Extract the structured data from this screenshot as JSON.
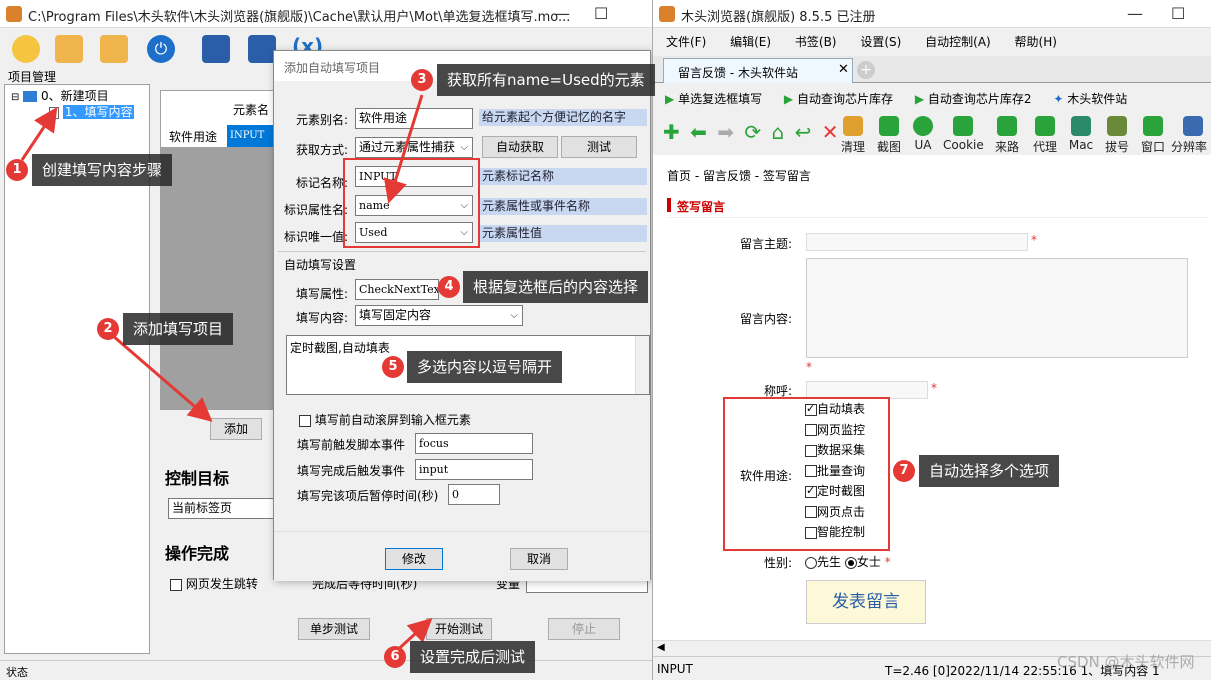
{
  "left_window": {
    "title": "C:\\Program Files\\木头软件\\木头浏览器(旗舰版)\\Cache\\默认用户\\Mot\\单选复选框填写.mo...",
    "project_panel_title": "项目管理",
    "tree": {
      "root": "0、新建项目",
      "child": "1、填写内容"
    },
    "grid": {
      "col_header": "元素名",
      "row_name": "软件用途",
      "row_value": "INPUT"
    },
    "add_button": "添加",
    "control_target_title": "控制目标",
    "current_tab": "当前标签页",
    "op_complete_title": "操作完成",
    "page_jump_label": "网页发生跳转",
    "wait_label": "完成后等待时间(秒)",
    "var_label": "变量",
    "step_test_button": "单步测试",
    "start_test_button": "开始测试",
    "stop_button": "停止",
    "status_label": "状态"
  },
  "dialog": {
    "title": "添加自动填写项目",
    "alias_label": "元素别名:",
    "alias_value": "软件用途",
    "alias_hint": "给元素起个方便记忆的名字",
    "method_label": "获取方式:",
    "method_value": "通过元素属性捕获",
    "auto_get_button": "自动获取",
    "test_button": "测试",
    "tag_label": "标记名称:",
    "tag_value": "INPUT",
    "tag_hint": "元素标记名称",
    "attr_label": "标识属性名:",
    "attr_value": "name",
    "attr_hint": "元素属性或事件名称",
    "unique_label": "标识唯一值:",
    "unique_value": "Used",
    "unique_hint": "元素属性值",
    "autofill_section": "自动填写设置",
    "fill_attr_label": "填写属性:",
    "fill_attr_value": "CheckNextText",
    "fill_content_label": "填写内容:",
    "fill_content_value": "填写固定内容",
    "textarea_value": "定时截图,自动填表",
    "scroll_check_label": "填写前自动滚屏到输入框元素",
    "before_event_label": "填写前触发脚本事件",
    "before_event_value": "focus",
    "after_event_label": "填写完成后触发事件",
    "after_event_value": "input",
    "pause_label": "填写完该项后暂停时间(秒)",
    "pause_value": "0",
    "modify_button": "修改",
    "cancel_button": "取消"
  },
  "browser": {
    "title": "木头浏览器(旗舰版) 8.5.5  已注册",
    "menu": [
      "文件(F)",
      "编辑(E)",
      "书签(B)",
      "设置(S)",
      "自动控制(A)",
      "帮助(H)"
    ],
    "tab": "留言反馈 - 木头软件站",
    "bookmarks": [
      "单选复选框填写",
      "自动查询芯片库存",
      "自动查询芯片库存2",
      "木头软件站"
    ],
    "tools": [
      "清理",
      "截图",
      "UA",
      "Cookie",
      "来路",
      "代理",
      "Mac",
      "拔号",
      "窗口",
      "分辨率"
    ],
    "breadcrumb": "首页 - 留言反馈 - 签写留言",
    "section_title": "签写留言",
    "subject_label": "留言主题:",
    "content_label": "留言内容:",
    "name_label": "称呼:",
    "usage_label": "软件用途:",
    "options": [
      {
        "label": "自动填表",
        "checked": true
      },
      {
        "label": "网页监控",
        "checked": false
      },
      {
        "label": "数据采集",
        "checked": false
      },
      {
        "label": "批量查询",
        "checked": false
      },
      {
        "label": "定时截图",
        "checked": true
      },
      {
        "label": "网页点击",
        "checked": false
      },
      {
        "label": "智能控制",
        "checked": false
      }
    ],
    "gender_label": "性别:",
    "gender_male": "先生",
    "gender_female": "女士",
    "submit": "发表留言",
    "status_left": "INPUT",
    "status_right": "T=2.46  [0]2022/11/14 22:55:16 1、填写内容 1",
    "watermark": "CSDN @木头软件网"
  },
  "callouts": [
    {
      "n": "1",
      "text": "创建填写内容步骤"
    },
    {
      "n": "2",
      "text": "添加填写项目"
    },
    {
      "n": "3",
      "text": "获取所有name=Used的元素"
    },
    {
      "n": "4",
      "text": "根据复选框后的内容选择"
    },
    {
      "n": "5",
      "text": "多选内容以逗号隔开"
    },
    {
      "n": "6",
      "text": "设置完成后测试"
    },
    {
      "n": "7",
      "text": "自动选择多个选项"
    }
  ],
  "required_mark": "*"
}
